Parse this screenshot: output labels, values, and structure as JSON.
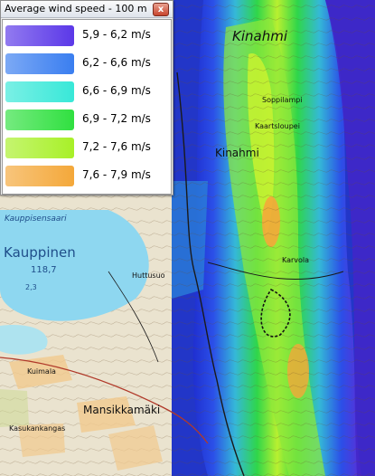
{
  "legend": {
    "title": "Average wind speed - 100 m",
    "close_label": "x",
    "items": [
      {
        "label": "5,9 - 6,2 m/s",
        "color": "#5b38e8"
      },
      {
        "label": "6,2 - 6,6 m/s",
        "color": "#3a7ef0"
      },
      {
        "label": "6,6 - 6,9 m/s",
        "color": "#38e8d8"
      },
      {
        "label": "6,9 - 7,2 m/s",
        "color": "#30e040"
      },
      {
        "label": "7,2 - 7,6 m/s",
        "color": "#a8f028"
      },
      {
        "label": "7,6 - 7,9 m/s",
        "color": "#f4a83a"
      }
    ]
  },
  "map": {
    "labels": {
      "kinahmi_hill": "Kinahmi",
      "kinahmi_village": "Kinahmi",
      "kauppinen": "Kauppinen",
      "kauppisensaari": "Kauppisensaari",
      "mansikkamaki": "Mansikkamäki",
      "kuimala": "Kuimala",
      "kasukankangas": "Kasukankangas",
      "soppilampi": "Soppilampi",
      "kaartsloupei": "Kaartsloupei",
      "karvola": "Karvola",
      "elevation_1187": "118,7",
      "elevation_23": "2,3",
      "huttusuo": "Huttusuo"
    }
  }
}
